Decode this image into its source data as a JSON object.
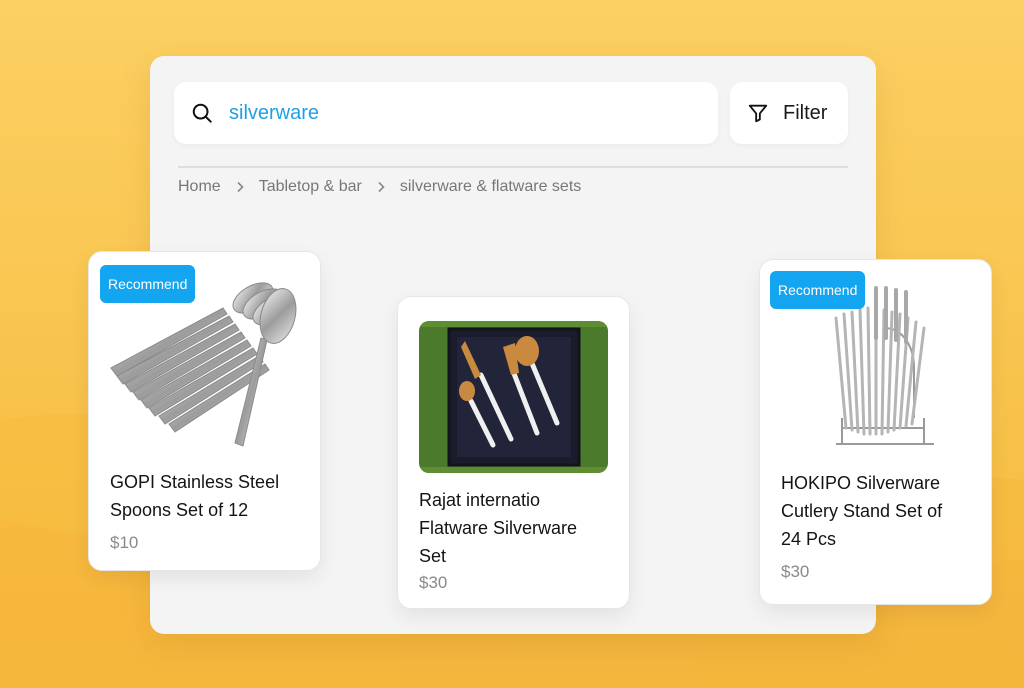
{
  "search": {
    "query": "silverware",
    "icon": "search-icon"
  },
  "filter": {
    "label": "Filter",
    "icon": "filter-funnel-icon"
  },
  "breadcrumb": [
    "Home",
    "Tabletop & bar",
    "silverware & flatware sets"
  ],
  "products": [
    {
      "badge": "Recommend",
      "title_line1": "GOPI Stainless Steel",
      "title_line2": "Spoons Set of 12",
      "title_line3": "",
      "price": "$10"
    },
    {
      "badge": "",
      "title_line1": "Rajat internatio",
      "title_line2": "Flatware Silverware",
      "title_line3": "Set",
      "price": "$30"
    },
    {
      "badge": "Recommend",
      "title_line1": "HOKIPO Silverware",
      "title_line2": "Cutlery Stand Set of",
      "title_line3": "24 Pcs",
      "price": "$30"
    }
  ],
  "colors": {
    "accent": "#13a5f0",
    "query_text": "#1ea0e6",
    "background": "#fcd063"
  }
}
